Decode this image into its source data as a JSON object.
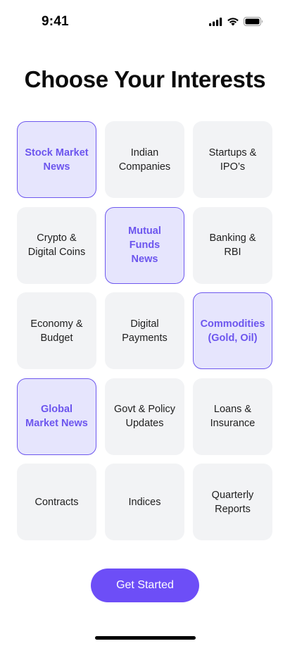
{
  "status_bar": {
    "time": "9:41",
    "icons": [
      "signal-icon",
      "wifi-icon",
      "battery-icon"
    ]
  },
  "title": "Choose Your Interests",
  "interests": [
    {
      "label": "Stock Market\nNews",
      "selected": true
    },
    {
      "label": "Indian\nCompanies",
      "selected": false
    },
    {
      "label": "Startups &\nIPO’s",
      "selected": false
    },
    {
      "label": "Crypto &\nDigital Coins",
      "selected": false
    },
    {
      "label": "Mutual Funds\nNews",
      "selected": true
    },
    {
      "label": "Banking & RBI",
      "selected": false
    },
    {
      "label": "Economy &\nBudget",
      "selected": false
    },
    {
      "label": "Digital\nPayments",
      "selected": false
    },
    {
      "label": "Commodities\n(Gold, Oil)",
      "selected": true
    },
    {
      "label": "Global\nMarket News",
      "selected": true
    },
    {
      "label": "Govt & Policy\nUpdates",
      "selected": false
    },
    {
      "label": "Loans &\nInsurance",
      "selected": false
    },
    {
      "label": "Contracts",
      "selected": false
    },
    {
      "label": "Indices",
      "selected": false
    },
    {
      "label": "Quarterly\nReports",
      "selected": false
    }
  ],
  "cta": {
    "label": "Get Started"
  },
  "colors": {
    "accent": "#6d4ef7",
    "selected_bg": "#e6e5fd",
    "selected_text": "#6c55ee",
    "tile_bg": "#f2f3f5"
  }
}
